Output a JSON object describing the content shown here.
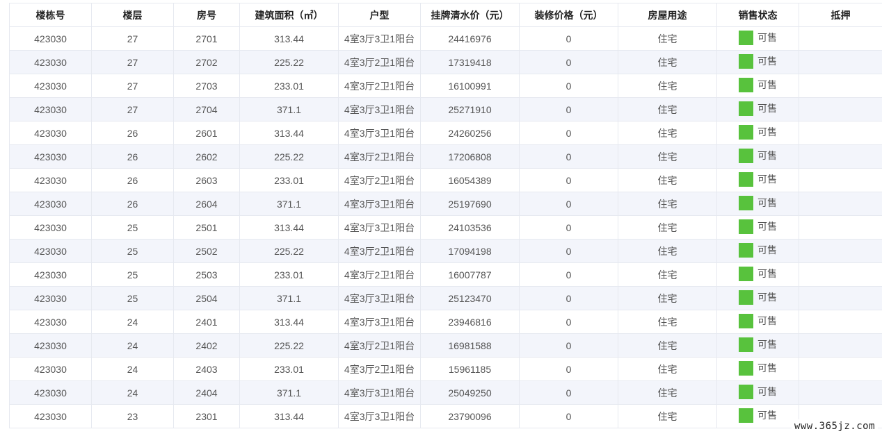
{
  "headers": [
    "楼栋号",
    "楼层",
    "房号",
    "建筑面积（㎡）",
    "户型",
    "挂牌清水价（元）",
    "装修价格（元）",
    "房屋用途",
    "销售状态",
    "抵押"
  ],
  "status_color": "#58c23d",
  "rows": [
    [
      "423030",
      "27",
      "2701",
      "313.44",
      "4室3厅3卫1阳台",
      "24416976",
      "0",
      "住宅",
      "可售",
      ""
    ],
    [
      "423030",
      "27",
      "2702",
      "225.22",
      "4室3厅2卫1阳台",
      "17319418",
      "0",
      "住宅",
      "可售",
      ""
    ],
    [
      "423030",
      "27",
      "2703",
      "233.01",
      "4室3厅2卫1阳台",
      "16100991",
      "0",
      "住宅",
      "可售",
      ""
    ],
    [
      "423030",
      "27",
      "2704",
      "371.1",
      "4室3厅3卫1阳台",
      "25271910",
      "0",
      "住宅",
      "可售",
      ""
    ],
    [
      "423030",
      "26",
      "2601",
      "313.44",
      "4室3厅3卫1阳台",
      "24260256",
      "0",
      "住宅",
      "可售",
      ""
    ],
    [
      "423030",
      "26",
      "2602",
      "225.22",
      "4室3厅2卫1阳台",
      "17206808",
      "0",
      "住宅",
      "可售",
      ""
    ],
    [
      "423030",
      "26",
      "2603",
      "233.01",
      "4室3厅2卫1阳台",
      "16054389",
      "0",
      "住宅",
      "可售",
      ""
    ],
    [
      "423030",
      "26",
      "2604",
      "371.1",
      "4室3厅3卫1阳台",
      "25197690",
      "0",
      "住宅",
      "可售",
      ""
    ],
    [
      "423030",
      "25",
      "2501",
      "313.44",
      "4室3厅3卫1阳台",
      "24103536",
      "0",
      "住宅",
      "可售",
      ""
    ],
    [
      "423030",
      "25",
      "2502",
      "225.22",
      "4室3厅2卫1阳台",
      "17094198",
      "0",
      "住宅",
      "可售",
      ""
    ],
    [
      "423030",
      "25",
      "2503",
      "233.01",
      "4室3厅2卫1阳台",
      "16007787",
      "0",
      "住宅",
      "可售",
      ""
    ],
    [
      "423030",
      "25",
      "2504",
      "371.1",
      "4室3厅3卫1阳台",
      "25123470",
      "0",
      "住宅",
      "可售",
      ""
    ],
    [
      "423030",
      "24",
      "2401",
      "313.44",
      "4室3厅3卫1阳台",
      "23946816",
      "0",
      "住宅",
      "可售",
      ""
    ],
    [
      "423030",
      "24",
      "2402",
      "225.22",
      "4室3厅2卫1阳台",
      "16981588",
      "0",
      "住宅",
      "可售",
      ""
    ],
    [
      "423030",
      "24",
      "2403",
      "233.01",
      "4室3厅2卫1阳台",
      "15961185",
      "0",
      "住宅",
      "可售",
      ""
    ],
    [
      "423030",
      "24",
      "2404",
      "371.1",
      "4室3厅3卫1阳台",
      "25049250",
      "0",
      "住宅",
      "可售",
      ""
    ],
    [
      "423030",
      "23",
      "2301",
      "313.44",
      "4室3厅3卫1阳台",
      "23790096",
      "0",
      "住宅",
      "可售",
      ""
    ]
  ],
  "watermark": "www.365jz.com"
}
